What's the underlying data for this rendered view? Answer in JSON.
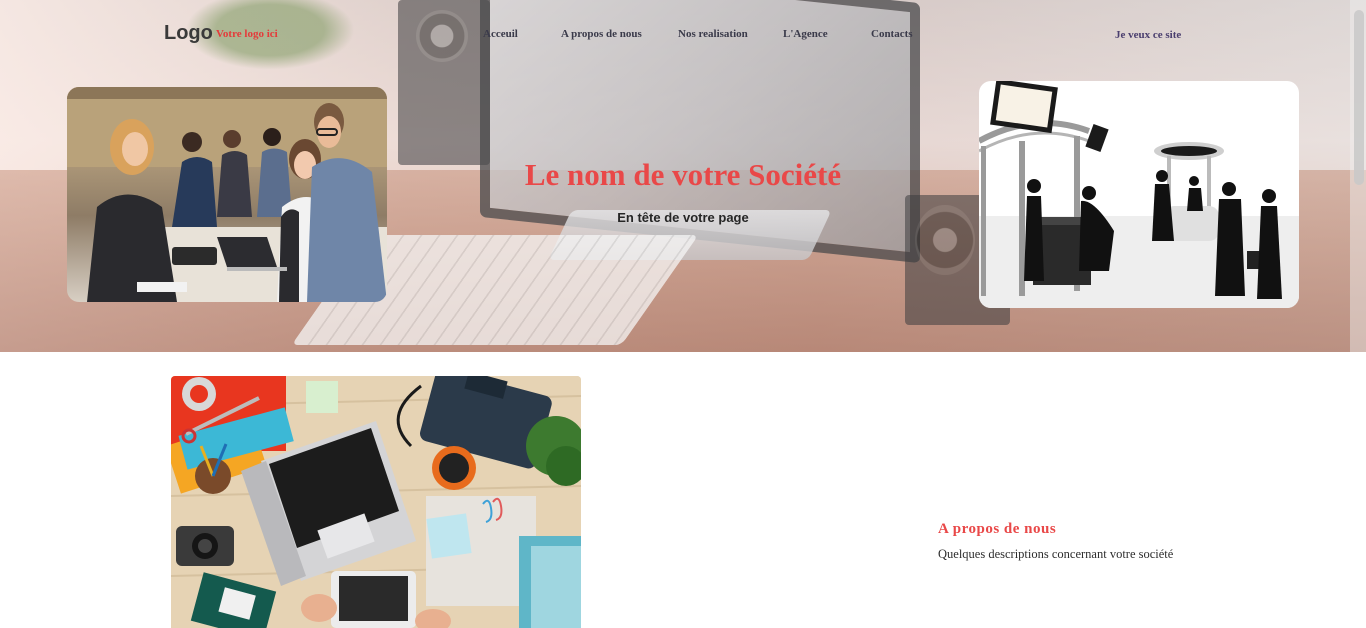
{
  "header": {
    "logo": "Logo",
    "logo_tagline": "Votre logo ici",
    "nav": [
      {
        "label": "Acceuil"
      },
      {
        "label": "A propos de nous"
      },
      {
        "label": "Nos realisation"
      },
      {
        "label": "L'Agence"
      },
      {
        "label": "Contacts"
      }
    ],
    "cta": "Je veux ce site"
  },
  "hero": {
    "title": "Le nom de votre Société",
    "subtitle": "En tête de votre page"
  },
  "about": {
    "title": "A propos de nous",
    "text": "Quelques descriptions concernant votre société"
  },
  "colors": {
    "accent": "#e94848",
    "nav_text": "#3a3a4a",
    "cta_text": "#4a3e6e"
  }
}
